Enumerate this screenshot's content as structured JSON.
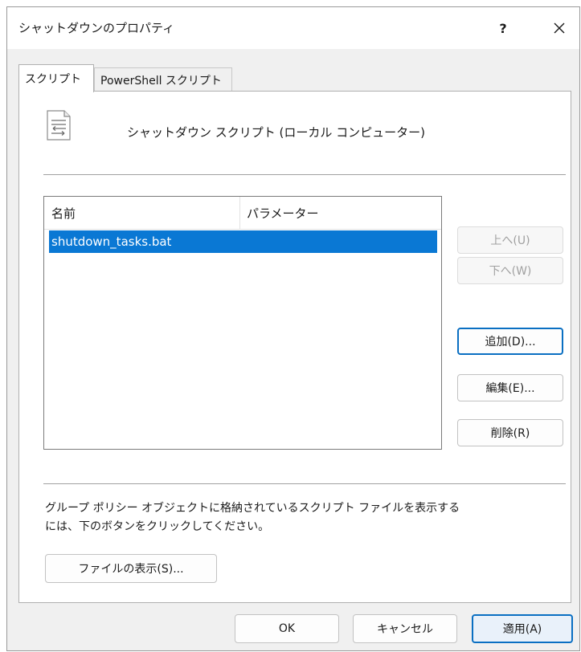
{
  "window": {
    "title": "シャットダウンのプロパティ",
    "help_glyph": "?",
    "close_glyph": "✕"
  },
  "tabs": [
    {
      "label": "スクリプト",
      "active": true
    },
    {
      "label": "PowerShell スクリプト",
      "active": false
    }
  ],
  "panel": {
    "heading": "シャットダウン スクリプト (ローカル コンピューター)",
    "icon": "script-document-icon"
  },
  "list": {
    "columns": [
      "名前",
      "パラメーター"
    ],
    "rows": [
      {
        "name": "shutdown_tasks.bat",
        "parameters": "",
        "selected": true
      }
    ]
  },
  "side_buttons": {
    "up": "上へ(U)",
    "down": "下へ(W)",
    "add": "追加(D)...",
    "edit": "編集(E)...",
    "delete": "削除(R)"
  },
  "info": {
    "text_line1": "グループ ポリシー オブジェクトに格納されているスクリプト ファイルを表示する",
    "text_line2": "には、下のボタンをクリックしてください。",
    "show_files_button": "ファイルの表示(S)..."
  },
  "footer": {
    "ok": "OK",
    "cancel": "キャンセル",
    "apply": "適用(A)"
  },
  "colors": {
    "selection": "#0a78d4",
    "focus_border": "#0a6fc2"
  }
}
